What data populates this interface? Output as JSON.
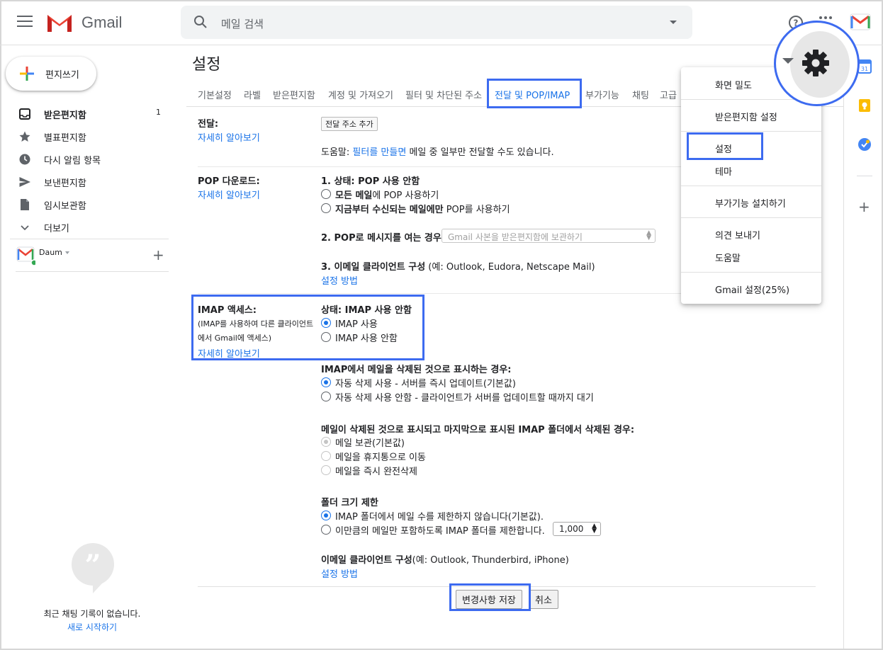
{
  "header": {
    "app_name": "Gmail",
    "search_placeholder": "메일 검색"
  },
  "sidebar": {
    "compose_label": "편지쓰기",
    "items": [
      {
        "label": "받은편지함",
        "count": "1",
        "icon": "inbox-icon"
      },
      {
        "label": "별표편지함",
        "count": "",
        "icon": "star-icon"
      },
      {
        "label": "다시 알림 항목",
        "count": "",
        "icon": "clock-icon"
      },
      {
        "label": "보낸편지함",
        "count": "",
        "icon": "send-icon"
      },
      {
        "label": "임시보관함",
        "count": "",
        "icon": "draft-icon"
      },
      {
        "label": "더보기",
        "count": "",
        "icon": "chevron-down-icon"
      }
    ],
    "account_name": "Daum",
    "chat_empty": "최근 채팅 기록이 없습니다.",
    "chat_start": "새로 시작하기"
  },
  "settings": {
    "title": "설정",
    "tabs": [
      "기본설정",
      "라벨",
      "받은편지함",
      "계정 및 가져오기",
      "필터 및 차단된 주소",
      "전달 및 POP/IMAP",
      "부가기능",
      "채팅",
      "고급"
    ],
    "active_tab": "전달 및 POP/IMAP",
    "forwarding": {
      "label": "전달:",
      "learn_more": "자세히 알아보기",
      "add_button": "전달 주소 추가",
      "help_prefix": "도움말: ",
      "help_link": "필터를 만들면",
      "help_suffix": " 메일 중 일부만 전달할 수도 있습니다."
    },
    "pop": {
      "label": "POP 다운로드:",
      "learn_more": "자세히 알아보기",
      "status": "1. 상태: POP 사용 안함",
      "opt1_bold": "모든 메일",
      "opt1_rest": "에 POP 사용하기",
      "opt2_bold": "지금부터 수신되는 메일에만",
      "opt2_rest": " POP를 사용하기",
      "when_opened": "2. POP로 메시지를 여는 경우",
      "when_opened_value": "Gmail 사본을 받은편지함에 보관하기",
      "client_bold": "3. 이메일 클라이언트 구성",
      "client_rest": " (예: Outlook, Eudora, Netscape Mail)",
      "setup_link": "설정 방법"
    },
    "imap": {
      "label": "IMAP 액세스:",
      "desc_line1": "(IMAP를 사용하여 다른 클라이언트",
      "desc_line2": "에서 Gmail에 액세스)",
      "learn_more": "자세히 알아보기",
      "status": "상태: IMAP 사용 안함",
      "enable": "IMAP 사용",
      "disable": "IMAP 사용 안함",
      "deleted_heading": "IMAP에서 메일을 삭제된 것으로 표시하는 경우:",
      "auto_expunge_on": "자동 삭제 사용 - 서버를 즉시 업데이트(기본값)",
      "auto_expunge_off": "자동 삭제 사용 안함 - 클라이언트가 서버를 업데이트할 때까지 대기",
      "expunged_heading": "메일이 삭제된 것으로 표시되고 마지막으로 표시된 IMAP 폴더에서 삭제된 경우:",
      "archive": "메일 보관(기본값)",
      "trash": "메일을 휴지통으로 이동",
      "delete_forever": "메일을 즉시 완전삭제",
      "folder_limit_heading": "폴더 크기 제한",
      "no_limit": "IMAP 폴더에서 메일 수를 제한하지 않습니다(기본값).",
      "limit": "이만큼의 메일만 포함하도록 IMAP 폴더를 제한합니다.",
      "limit_value": "1,000",
      "client_bold": "이메일 클라이언트 구성",
      "client_rest": "(예: Outlook, Thunderbird, iPhone)",
      "setup_link": "설정 방법"
    },
    "save_button": "변경사항 저장",
    "cancel_button": "취소"
  },
  "gear_menu": {
    "items": [
      "화면 밀도",
      "받은편지함 설정",
      "설정",
      "테마",
      "부가기능 설치하기",
      "의견 보내기",
      "도움말",
      "Gmail 설정(25%)"
    ]
  },
  "colors": {
    "accent": "#1a73e8",
    "highlight": "#3d6bf0",
    "gmail_red": "#ea4335"
  }
}
